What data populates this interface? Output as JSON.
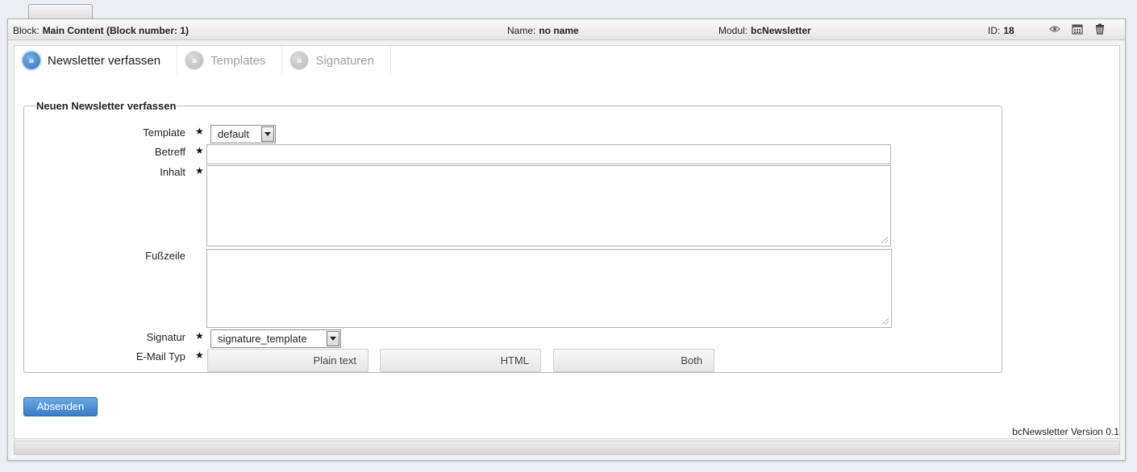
{
  "header": {
    "block_label": "Block:",
    "block_value": "Main Content (Block number: 1)",
    "name_label": "Name:",
    "name_value": "no name",
    "modul_label": "Modul:",
    "modul_value": "bcNewsletter",
    "id_label": "ID:",
    "id_value": "18",
    "icons": [
      "eye-icon",
      "calendar-icon",
      "trash-icon"
    ]
  },
  "tabs": [
    {
      "label": "Newsletter verfassen",
      "active": true
    },
    {
      "label": "Templates",
      "active": false
    },
    {
      "label": "Signaturen",
      "active": false
    }
  ],
  "form": {
    "legend": "Neuen Newsletter verfassen",
    "template_label": "Template",
    "template_value": "default",
    "betreff_label": "Betreff",
    "betreff_value": "",
    "inhalt_label": "Inhalt",
    "inhalt_value": "",
    "fusszeile_label": "Fußzeile",
    "fusszeile_value": "",
    "signatur_label": "Signatur",
    "signatur_value": "signature_template",
    "email_typ_label": "E-Mail Typ",
    "email_typ_options": [
      "Plain text",
      "HTML",
      "Both"
    ],
    "required_marker": "★"
  },
  "submit_label": "Absenden",
  "version_text": "bcNewsletter Version 0.1",
  "colors": {
    "accent": "#3a7cc6",
    "active_tab_bullet": "#2f73c0",
    "inactive_tab_bullet": "#bdbdbd"
  }
}
